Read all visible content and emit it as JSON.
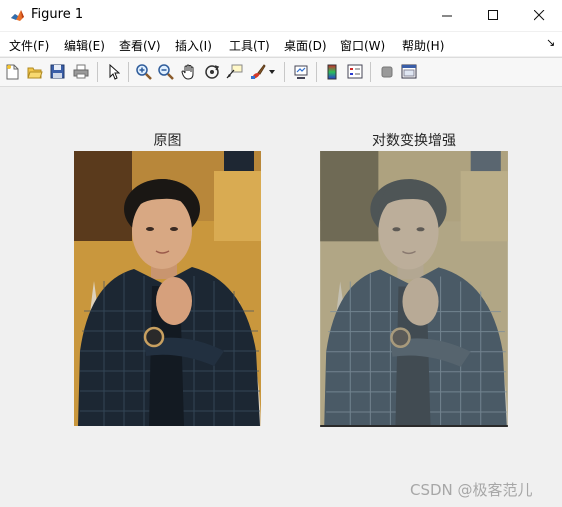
{
  "window": {
    "title": "Figure 1"
  },
  "menubar": {
    "items": [
      "文件(F)",
      "编辑(E)",
      "查看(V)",
      "插入(I)",
      "工具(T)",
      "桌面(D)",
      "窗口(W)",
      "帮助(H)"
    ]
  },
  "toolbar": {
    "icons": [
      "new-figure-icon",
      "open-file-icon",
      "save-icon",
      "print-icon",
      "pointer-icon",
      "zoom-in-icon",
      "zoom-out-icon",
      "pan-hand-icon",
      "rotate-3d-icon",
      "data-cursor-icon",
      "brush-icon",
      "brush-dropdown-icon",
      "link-plot-icon",
      "colorbar-icon",
      "legend-icon",
      "hide-plot-tools-icon",
      "show-plot-tools-icon"
    ]
  },
  "figure": {
    "subplots": [
      {
        "title": "原图"
      },
      {
        "title": "对数变换增强"
      }
    ]
  },
  "watermark": "CSDN @极客范儿",
  "colors": {
    "background": "#f0f0f0",
    "titlebar": "#ffffff",
    "original_wall": "#c9973d",
    "enhanced_wall": "#b1a685",
    "shirt_dark": "#1c2733"
  }
}
